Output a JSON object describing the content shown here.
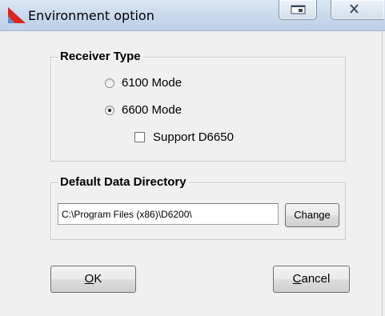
{
  "window": {
    "title": "Environment option",
    "icons": {
      "app": "app-red-triangle-icon",
      "restore": "restore-icon",
      "close": "close-icon"
    }
  },
  "receiver_type": {
    "legend": "Receiver Type",
    "options": [
      {
        "label": "6100 Mode",
        "checked": false
      },
      {
        "label": "6600 Mode",
        "checked": true
      }
    ],
    "support": {
      "label": "Support D6650",
      "checked": false
    }
  },
  "data_directory": {
    "legend": "Default Data Directory",
    "path": "C:\\Program Files (x86)\\D6200\\",
    "change_label": "Change"
  },
  "buttons": {
    "ok": {
      "mnemonic": "O",
      "rest": "K"
    },
    "cancel": {
      "mnemonic": "C",
      "rest": "ancel"
    }
  },
  "colors": {
    "titlebar": "#cbdbee",
    "window_bg": "#f0f0f0",
    "icon_red": "#e2231a",
    "icon_blue": "#2f6fb3"
  }
}
